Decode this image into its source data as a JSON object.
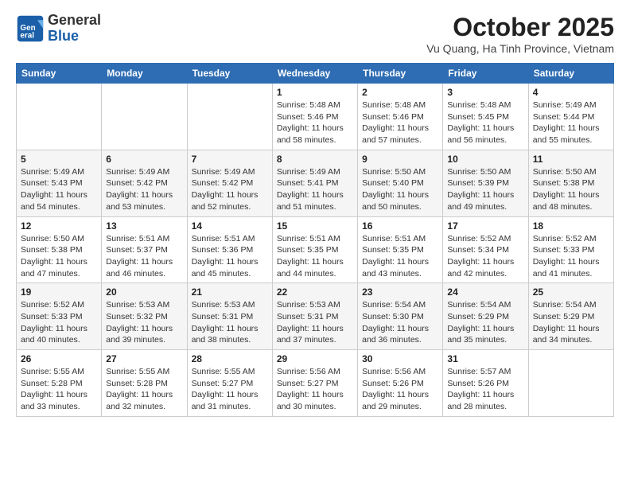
{
  "header": {
    "logo_line1": "General",
    "logo_line2": "Blue",
    "title": "October 2025",
    "subtitle": "Vu Quang, Ha Tinh Province, Vietnam"
  },
  "days_of_week": [
    "Sunday",
    "Monday",
    "Tuesday",
    "Wednesday",
    "Thursday",
    "Friday",
    "Saturday"
  ],
  "weeks": [
    [
      {
        "day": "",
        "info": ""
      },
      {
        "day": "",
        "info": ""
      },
      {
        "day": "",
        "info": ""
      },
      {
        "day": "1",
        "info": "Sunrise: 5:48 AM\nSunset: 5:46 PM\nDaylight: 11 hours\nand 58 minutes."
      },
      {
        "day": "2",
        "info": "Sunrise: 5:48 AM\nSunset: 5:46 PM\nDaylight: 11 hours\nand 57 minutes."
      },
      {
        "day": "3",
        "info": "Sunrise: 5:48 AM\nSunset: 5:45 PM\nDaylight: 11 hours\nand 56 minutes."
      },
      {
        "day": "4",
        "info": "Sunrise: 5:49 AM\nSunset: 5:44 PM\nDaylight: 11 hours\nand 55 minutes."
      }
    ],
    [
      {
        "day": "5",
        "info": "Sunrise: 5:49 AM\nSunset: 5:43 PM\nDaylight: 11 hours\nand 54 minutes."
      },
      {
        "day": "6",
        "info": "Sunrise: 5:49 AM\nSunset: 5:42 PM\nDaylight: 11 hours\nand 53 minutes."
      },
      {
        "day": "7",
        "info": "Sunrise: 5:49 AM\nSunset: 5:42 PM\nDaylight: 11 hours\nand 52 minutes."
      },
      {
        "day": "8",
        "info": "Sunrise: 5:49 AM\nSunset: 5:41 PM\nDaylight: 11 hours\nand 51 minutes."
      },
      {
        "day": "9",
        "info": "Sunrise: 5:50 AM\nSunset: 5:40 PM\nDaylight: 11 hours\nand 50 minutes."
      },
      {
        "day": "10",
        "info": "Sunrise: 5:50 AM\nSunset: 5:39 PM\nDaylight: 11 hours\nand 49 minutes."
      },
      {
        "day": "11",
        "info": "Sunrise: 5:50 AM\nSunset: 5:38 PM\nDaylight: 11 hours\nand 48 minutes."
      }
    ],
    [
      {
        "day": "12",
        "info": "Sunrise: 5:50 AM\nSunset: 5:38 PM\nDaylight: 11 hours\nand 47 minutes."
      },
      {
        "day": "13",
        "info": "Sunrise: 5:51 AM\nSunset: 5:37 PM\nDaylight: 11 hours\nand 46 minutes."
      },
      {
        "day": "14",
        "info": "Sunrise: 5:51 AM\nSunset: 5:36 PM\nDaylight: 11 hours\nand 45 minutes."
      },
      {
        "day": "15",
        "info": "Sunrise: 5:51 AM\nSunset: 5:35 PM\nDaylight: 11 hours\nand 44 minutes."
      },
      {
        "day": "16",
        "info": "Sunrise: 5:51 AM\nSunset: 5:35 PM\nDaylight: 11 hours\nand 43 minutes."
      },
      {
        "day": "17",
        "info": "Sunrise: 5:52 AM\nSunset: 5:34 PM\nDaylight: 11 hours\nand 42 minutes."
      },
      {
        "day": "18",
        "info": "Sunrise: 5:52 AM\nSunset: 5:33 PM\nDaylight: 11 hours\nand 41 minutes."
      }
    ],
    [
      {
        "day": "19",
        "info": "Sunrise: 5:52 AM\nSunset: 5:33 PM\nDaylight: 11 hours\nand 40 minutes."
      },
      {
        "day": "20",
        "info": "Sunrise: 5:53 AM\nSunset: 5:32 PM\nDaylight: 11 hours\nand 39 minutes."
      },
      {
        "day": "21",
        "info": "Sunrise: 5:53 AM\nSunset: 5:31 PM\nDaylight: 11 hours\nand 38 minutes."
      },
      {
        "day": "22",
        "info": "Sunrise: 5:53 AM\nSunset: 5:31 PM\nDaylight: 11 hours\nand 37 minutes."
      },
      {
        "day": "23",
        "info": "Sunrise: 5:54 AM\nSunset: 5:30 PM\nDaylight: 11 hours\nand 36 minutes."
      },
      {
        "day": "24",
        "info": "Sunrise: 5:54 AM\nSunset: 5:29 PM\nDaylight: 11 hours\nand 35 minutes."
      },
      {
        "day": "25",
        "info": "Sunrise: 5:54 AM\nSunset: 5:29 PM\nDaylight: 11 hours\nand 34 minutes."
      }
    ],
    [
      {
        "day": "26",
        "info": "Sunrise: 5:55 AM\nSunset: 5:28 PM\nDaylight: 11 hours\nand 33 minutes."
      },
      {
        "day": "27",
        "info": "Sunrise: 5:55 AM\nSunset: 5:28 PM\nDaylight: 11 hours\nand 32 minutes."
      },
      {
        "day": "28",
        "info": "Sunrise: 5:55 AM\nSunset: 5:27 PM\nDaylight: 11 hours\nand 31 minutes."
      },
      {
        "day": "29",
        "info": "Sunrise: 5:56 AM\nSunset: 5:27 PM\nDaylight: 11 hours\nand 30 minutes."
      },
      {
        "day": "30",
        "info": "Sunrise: 5:56 AM\nSunset: 5:26 PM\nDaylight: 11 hours\nand 29 minutes."
      },
      {
        "day": "31",
        "info": "Sunrise: 5:57 AM\nSunset: 5:26 PM\nDaylight: 11 hours\nand 28 minutes."
      },
      {
        "day": "",
        "info": ""
      }
    ]
  ]
}
